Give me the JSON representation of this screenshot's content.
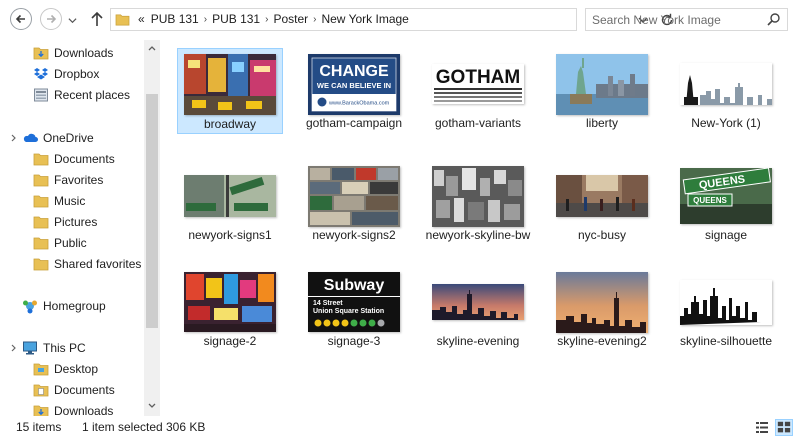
{
  "address": {
    "overflow": "«",
    "crumbs": [
      "PUB 131",
      "PUB 131",
      "Poster",
      "New York Image"
    ]
  },
  "search": {
    "placeholder": "Search New York Image"
  },
  "nav": {
    "items": [
      {
        "label": "Downloads",
        "icon": "downloads-folder-icon"
      },
      {
        "label": "Dropbox",
        "icon": "dropbox-icon"
      },
      {
        "label": "Recent places",
        "icon": "recent-places-icon"
      },
      {
        "label": "OneDrive",
        "icon": "onedrive-icon"
      },
      {
        "label": "Documents",
        "icon": "folder-icon"
      },
      {
        "label": "Favorites",
        "icon": "folder-icon"
      },
      {
        "label": "Music",
        "icon": "folder-icon"
      },
      {
        "label": "Pictures",
        "icon": "folder-icon"
      },
      {
        "label": "Public",
        "icon": "folder-icon"
      },
      {
        "label": "Shared favorites",
        "icon": "folder-icon"
      },
      {
        "label": "Homegroup",
        "icon": "homegroup-icon"
      },
      {
        "label": "This PC",
        "icon": "this-pc-icon"
      },
      {
        "label": "Desktop",
        "icon": "desktop-folder-icon"
      },
      {
        "label": "Documents",
        "icon": "documents-folder-icon"
      },
      {
        "label": "Downloads",
        "icon": "downloads-folder-icon"
      }
    ]
  },
  "files": [
    {
      "name": "broadway",
      "selected": true
    },
    {
      "name": "gotham-campaign",
      "thumb_text": [
        "CHANGE",
        "WE CAN BELIEVE IN",
        "www.BarackObama.com"
      ]
    },
    {
      "name": "gotham-variants",
      "thumb_text": [
        "GOTHAM"
      ]
    },
    {
      "name": "liberty"
    },
    {
      "name": "New-York (1)"
    },
    {
      "name": "newyork-signs1"
    },
    {
      "name": "newyork-signs2"
    },
    {
      "name": "newyork-skyline-bw"
    },
    {
      "name": "nyc-busy"
    },
    {
      "name": "signage",
      "thumb_text": [
        "QUEENS",
        "QUEENS"
      ]
    },
    {
      "name": "signage-2"
    },
    {
      "name": "signage-3",
      "thumb_text": [
        "Subway",
        "14 Street",
        "Union Square Station"
      ]
    },
    {
      "name": "skyline-evening"
    },
    {
      "name": "skyline-evening2"
    },
    {
      "name": "skyline-silhouette"
    }
  ],
  "status": {
    "count": "15 items",
    "selection": "1 item selected",
    "size": "306 KB"
  },
  "colors": {
    "selection": "#cce8ff",
    "selection_border": "#99d1ff",
    "folder": "#e8c054",
    "accent": "#1e6fd9"
  }
}
